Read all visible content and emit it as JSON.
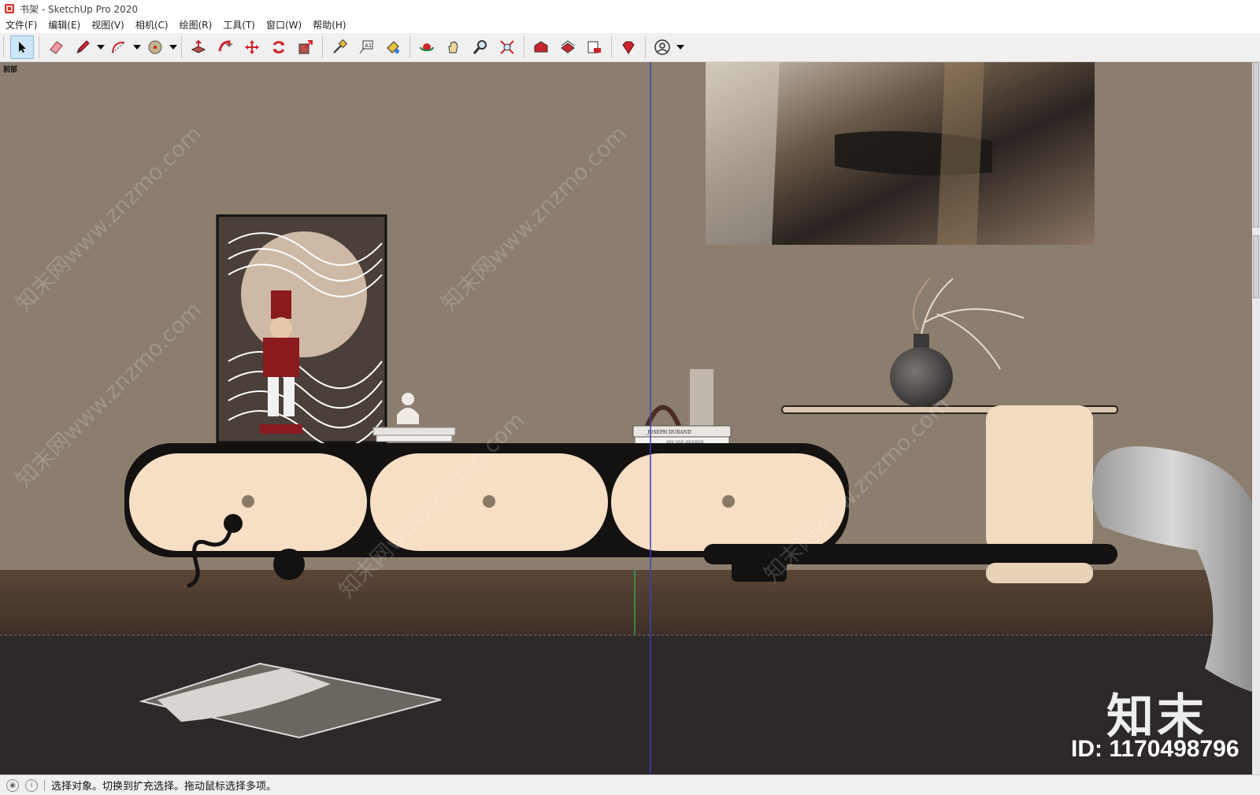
{
  "window": {
    "title": "书架 - SketchUp Pro 2020"
  },
  "menu": {
    "items": [
      {
        "label": "文件(F)"
      },
      {
        "label": "编辑(E)"
      },
      {
        "label": "视图(V)"
      },
      {
        "label": "相机(C)"
      },
      {
        "label": "绘图(R)"
      },
      {
        "label": "工具(T)"
      },
      {
        "label": "窗口(W)"
      },
      {
        "label": "帮助(H)"
      }
    ]
  },
  "toolbar": {
    "tools": [
      "select-icon",
      "eraser-icon",
      "pencil-icon",
      "arc-icon",
      "paint-bucket-icon",
      "push-pull-icon",
      "follow-me-icon",
      "move-icon",
      "rotate-icon",
      "scale-icon",
      "tape-measure-icon",
      "text-icon",
      "paint-icon",
      "orbit-icon",
      "pan-icon",
      "zoom-icon",
      "zoom-extents-icon",
      "warehouse-icon",
      "extension-warehouse-icon",
      "layout-icon",
      "ruby-icon",
      "account-icon"
    ]
  },
  "viewport": {
    "scene_label": "前部",
    "book_title": "JOSEPH DURAND",
    "book_subtitle": "HIS VAN HEEREN",
    "watermark_diag": "知末网www.znzmo.com",
    "watermark_brand": "知末",
    "watermark_id": "ID: 1170498796"
  },
  "status": {
    "message": "选择对象。切换到扩充选择。拖动鼠标选择多项。"
  },
  "colors": {
    "wall": "#8c7e6e",
    "floor": "#4a3a30",
    "rug": "#2d2928",
    "cabinet_front": "#f6dfc4",
    "cabinet_body": "#141111"
  }
}
